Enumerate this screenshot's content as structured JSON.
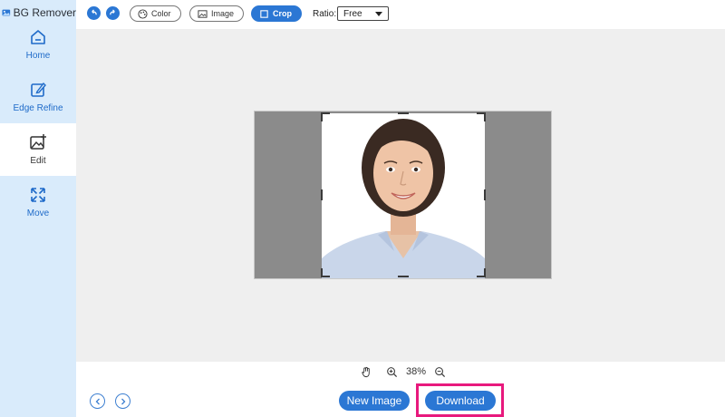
{
  "app": {
    "name": "BG Remover"
  },
  "sidebar": {
    "items": [
      {
        "label": "Home",
        "icon": "home-icon"
      },
      {
        "label": "Edge Refine",
        "icon": "edit-pen-icon"
      },
      {
        "label": "Edit",
        "icon": "image-edit-icon",
        "active": true
      },
      {
        "label": "Move",
        "icon": "move-arrows-icon"
      }
    ]
  },
  "toolbar": {
    "undo_icon": "undo-icon",
    "redo_icon": "redo-icon",
    "color_label": "Color",
    "image_label": "Image",
    "crop_label": "Crop",
    "ratio_label": "Ratio:",
    "ratio_value": "Free"
  },
  "zoom": {
    "level": "38%"
  },
  "bottom": {
    "new_image_label": "New Image",
    "download_label": "Download"
  },
  "colors": {
    "accent": "#2b77d4",
    "sidebar_bg": "#d9ebfb",
    "highlight": "#e8197d",
    "canvas_bg": "#8b8b8b"
  }
}
